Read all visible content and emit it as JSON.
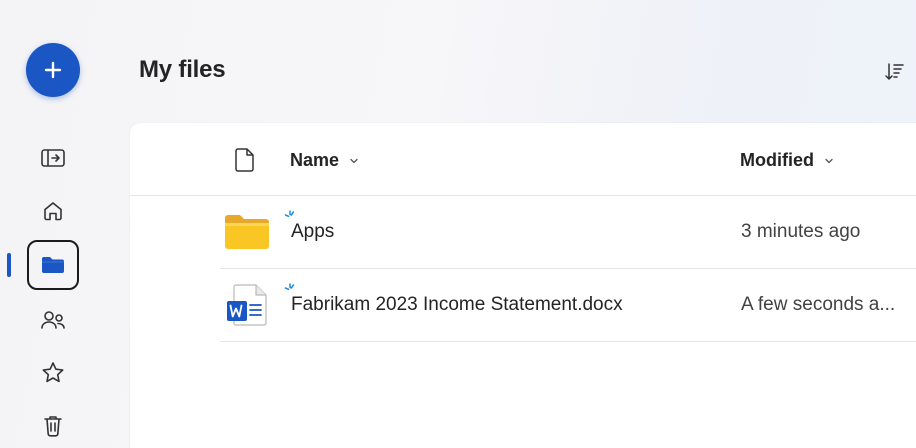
{
  "page": {
    "title": "My files"
  },
  "nav_rail": {
    "items": [
      {
        "id": "create",
        "icon": "plus-icon",
        "color": "#1a56c4"
      },
      {
        "id": "toggle-pane",
        "icon": "panel-toggle-icon"
      },
      {
        "id": "home",
        "icon": "home-icon"
      },
      {
        "id": "my-files",
        "icon": "folder-icon",
        "selected": true
      },
      {
        "id": "shared",
        "icon": "people-icon"
      },
      {
        "id": "favorites",
        "icon": "star-icon"
      },
      {
        "id": "recycle-bin",
        "icon": "trash-icon"
      }
    ],
    "accent_color": "#1a56c4"
  },
  "file_list": {
    "columns": [
      {
        "key": "type",
        "icon": "document-icon"
      },
      {
        "key": "name",
        "label": "Name"
      },
      {
        "key": "modified",
        "label": "Modified"
      }
    ],
    "rows": [
      {
        "type": "folder",
        "icon": "folder-yellow-icon",
        "name": "Apps",
        "modified": "3 minutes ago",
        "new": true
      },
      {
        "type": "word-document",
        "icon": "word-doc-icon",
        "name": "Fabrikam 2023 Income Statement.docx",
        "modified": "A few seconds a...",
        "new": true
      }
    ]
  }
}
